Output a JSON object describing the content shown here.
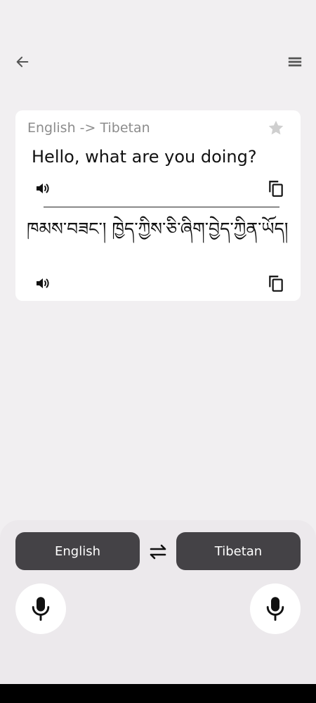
{
  "header": {
    "back_icon": "arrow-left-icon",
    "menu_icon": "menu-icon"
  },
  "card": {
    "language_pair": "English -> Tibetan",
    "favorite_icon": "star-icon",
    "source_text": "Hello, what are you doing?",
    "translated_text": "ཁམས་བཟང་། ཁྱེད་ཀྱིས་ཅི་ཞིག་བྱེད་ཀྱིན་ཡོད།",
    "speak_icon": "speaker-icon",
    "copy_icon": "copy-icon"
  },
  "bottom": {
    "source_language": "English",
    "target_language": "Tibetan",
    "swap_icon": "swap-icon",
    "mic_icon": "microphone-icon"
  },
  "colors": {
    "background": "#f1eff1",
    "card": "#ffffff",
    "button": "#444246",
    "muted_text": "#8c8c8c"
  }
}
